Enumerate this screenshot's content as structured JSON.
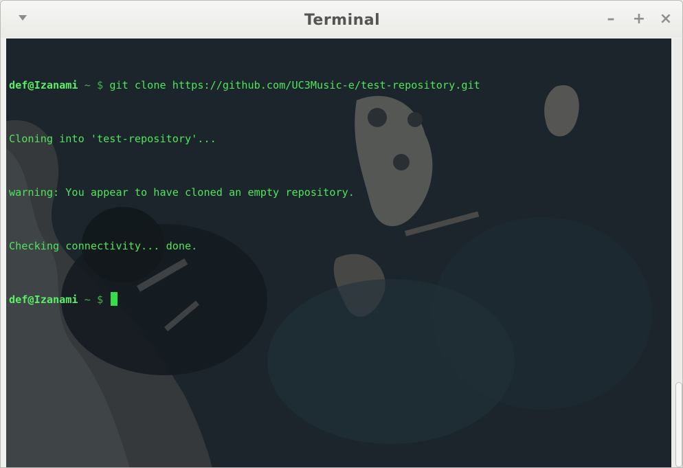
{
  "window": {
    "title": "Terminal",
    "minimize_label": "–",
    "maximize_label": "+",
    "close_label": "×"
  },
  "terminal": {
    "lines": [
      {
        "prompt": "def@Izanami",
        "sep": " ~ $ ",
        "text": "git clone https://github.com/UC3Music-e/test-repository.git"
      },
      {
        "prompt": "",
        "sep": "",
        "text": "Cloning into 'test-repository'..."
      },
      {
        "prompt": "",
        "sep": "",
        "text": "warning: You appear to have cloned an empty repository."
      },
      {
        "prompt": "",
        "sep": "",
        "text": "Checking connectivity... done."
      },
      {
        "prompt": "def@Izanami",
        "sep": " ~ $ ",
        "text": ""
      }
    ],
    "colors": {
      "text": "#4ee65a",
      "background": "#1a2329",
      "cursor": "#33e04a"
    }
  }
}
